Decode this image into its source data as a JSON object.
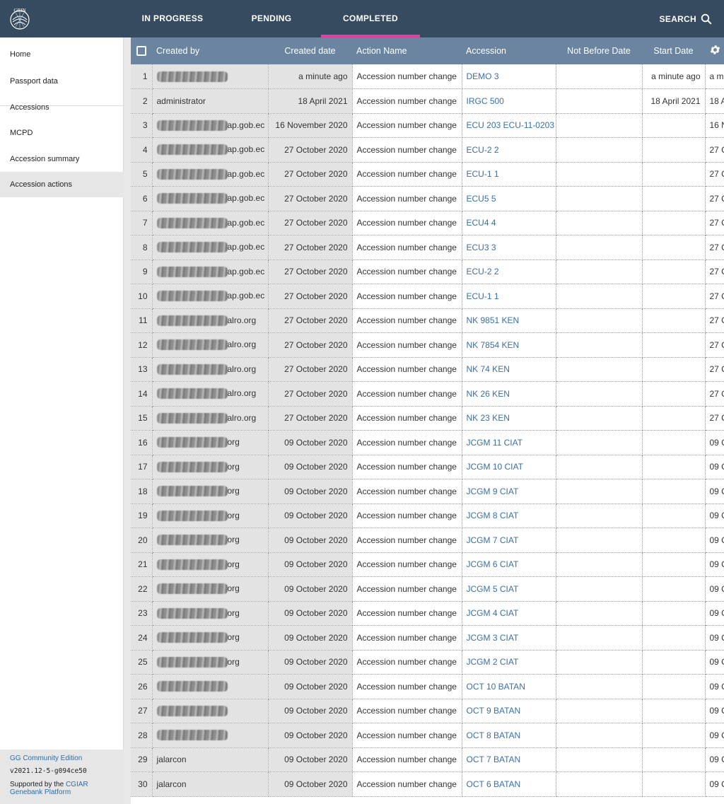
{
  "topbar": {
    "logo_text": "GRIN",
    "tabs": [
      {
        "label": "IN PROGRESS",
        "active": false
      },
      {
        "label": "PENDING",
        "active": false
      },
      {
        "label": "COMPLETED",
        "active": true
      }
    ],
    "search_label": "SEARCH",
    "search_icon": "search-icon",
    "accent_color": "#e040a0",
    "bg_color": "#364a60"
  },
  "sidebar": {
    "items": [
      {
        "label": "Home",
        "selected": false
      },
      {
        "label": "Passport data",
        "selected": false
      },
      {
        "label": "Accessions",
        "selected": false
      },
      {
        "label": "MCPD",
        "selected": false
      },
      {
        "label": "Accession summary",
        "selected": false
      },
      {
        "label": "Accession actions",
        "selected": true
      }
    ],
    "footer": {
      "edition": "GG Community Edition",
      "version": "v2021.12-5-g094ce50",
      "supported_prefix": "Supported by the",
      "supported_link": "CGIAR Genebank Platform"
    }
  },
  "table": {
    "columns": [
      "Created by",
      "Created date",
      "Action Name",
      "Accession",
      "Not Before Date",
      "Start Date"
    ],
    "settings_icon": "gear-icon",
    "rows": [
      {
        "n": "1",
        "created_by": "",
        "redacted": true,
        "created_date": "a minute ago",
        "action": "Accession number change",
        "accession": "DEMO 3",
        "not_before": "",
        "start": "a minute ago",
        "extra": "a m"
      },
      {
        "n": "2",
        "created_by": "administrator",
        "redacted": false,
        "created_date": "18 April 2021",
        "action": "Accession number change",
        "accession": "IRGC 500",
        "not_before": "",
        "start": "18 April 2021",
        "extra": "18 A"
      },
      {
        "n": "3",
        "created_by": "ap.gob.ec",
        "redacted": true,
        "created_date": "16 November 2020",
        "action": "Accession number change",
        "accession": "ECU 203 ECU-11-0203",
        "not_before": "",
        "start": "",
        "extra": "16 N"
      },
      {
        "n": "4",
        "created_by": "ap.gob.ec",
        "redacted": true,
        "created_date": "27 October 2020",
        "action": "Accession number change",
        "accession": "ECU-2 2",
        "not_before": "",
        "start": "",
        "extra": "27 C"
      },
      {
        "n": "5",
        "created_by": "ap.gob.ec",
        "redacted": true,
        "created_date": "27 October 2020",
        "action": "Accession number change",
        "accession": "ECU-1 1",
        "not_before": "",
        "start": "",
        "extra": "27 C"
      },
      {
        "n": "6",
        "created_by": "ap.gob.ec",
        "redacted": true,
        "created_date": "27 October 2020",
        "action": "Accession number change",
        "accession": "ECU5 5",
        "not_before": "",
        "start": "",
        "extra": "27 C"
      },
      {
        "n": "7",
        "created_by": "ap.gob.ec",
        "redacted": true,
        "created_date": "27 October 2020",
        "action": "Accession number change",
        "accession": "ECU4 4",
        "not_before": "",
        "start": "",
        "extra": "27 C"
      },
      {
        "n": "8",
        "created_by": "ap.gob.ec",
        "redacted": true,
        "created_date": "27 October 2020",
        "action": "Accession number change",
        "accession": "ECU3 3",
        "not_before": "",
        "start": "",
        "extra": "27 C"
      },
      {
        "n": "9",
        "created_by": "ap.gob.ec",
        "redacted": true,
        "created_date": "27 October 2020",
        "action": "Accession number change",
        "accession": "ECU-2 2",
        "not_before": "",
        "start": "",
        "extra": "27 C"
      },
      {
        "n": "10",
        "created_by": "ap.gob.ec",
        "redacted": true,
        "created_date": "27 October 2020",
        "action": "Accession number change",
        "accession": "ECU-1 1",
        "not_before": "",
        "start": "",
        "extra": "27 C"
      },
      {
        "n": "11",
        "created_by": "alro.org",
        "redacted": true,
        "created_date": "27 October 2020",
        "action": "Accession number change",
        "accession": "NK 9851 KEN",
        "not_before": "",
        "start": "",
        "extra": "27 C"
      },
      {
        "n": "12",
        "created_by": "alro.org",
        "redacted": true,
        "created_date": "27 October 2020",
        "action": "Accession number change",
        "accession": "NK 7854 KEN",
        "not_before": "",
        "start": "",
        "extra": "27 C"
      },
      {
        "n": "13",
        "created_by": "alro.org",
        "redacted": true,
        "created_date": "27 October 2020",
        "action": "Accession number change",
        "accession": "NK 74 KEN",
        "not_before": "",
        "start": "",
        "extra": "27 C"
      },
      {
        "n": "14",
        "created_by": "alro.org",
        "redacted": true,
        "created_date": "27 October 2020",
        "action": "Accession number change",
        "accession": "NK 26 KEN",
        "not_before": "",
        "start": "",
        "extra": "27 C"
      },
      {
        "n": "15",
        "created_by": "alro.org",
        "redacted": true,
        "created_date": "27 October 2020",
        "action": "Accession number change",
        "accession": "NK 23 KEN",
        "not_before": "",
        "start": "",
        "extra": "27 C"
      },
      {
        "n": "16",
        "created_by": "org",
        "redacted": true,
        "created_date": "09 October 2020",
        "action": "Accession number change",
        "accession": "JCGM 11 CIAT",
        "not_before": "",
        "start": "",
        "extra": "09 C"
      },
      {
        "n": "17",
        "created_by": "org",
        "redacted": true,
        "created_date": "09 October 2020",
        "action": "Accession number change",
        "accession": "JCGM 10 CIAT",
        "not_before": "",
        "start": "",
        "extra": "09 C"
      },
      {
        "n": "18",
        "created_by": "org",
        "redacted": true,
        "created_date": "09 October 2020",
        "action": "Accession number change",
        "accession": "JCGM 9 CIAT",
        "not_before": "",
        "start": "",
        "extra": "09 C"
      },
      {
        "n": "19",
        "created_by": "org",
        "redacted": true,
        "created_date": "09 October 2020",
        "action": "Accession number change",
        "accession": "JCGM 8 CIAT",
        "not_before": "",
        "start": "",
        "extra": "09 C"
      },
      {
        "n": "20",
        "created_by": "org",
        "redacted": true,
        "created_date": "09 October 2020",
        "action": "Accession number change",
        "accession": "JCGM 7 CIAT",
        "not_before": "",
        "start": "",
        "extra": "09 C"
      },
      {
        "n": "21",
        "created_by": "org",
        "redacted": true,
        "created_date": "09 October 2020",
        "action": "Accession number change",
        "accession": "JCGM 6 CIAT",
        "not_before": "",
        "start": "",
        "extra": "09 C"
      },
      {
        "n": "22",
        "created_by": "org",
        "redacted": true,
        "created_date": "09 October 2020",
        "action": "Accession number change",
        "accession": "JCGM 5 CIAT",
        "not_before": "",
        "start": "",
        "extra": "09 C"
      },
      {
        "n": "23",
        "created_by": "org",
        "redacted": true,
        "created_date": "09 October 2020",
        "action": "Accession number change",
        "accession": "JCGM 4 CIAT",
        "not_before": "",
        "start": "",
        "extra": "09 C"
      },
      {
        "n": "24",
        "created_by": "org",
        "redacted": true,
        "created_date": "09 October 2020",
        "action": "Accession number change",
        "accession": "JCGM 3 CIAT",
        "not_before": "",
        "start": "",
        "extra": "09 C"
      },
      {
        "n": "25",
        "created_by": "org",
        "redacted": true,
        "created_date": "09 October 2020",
        "action": "Accession number change",
        "accession": "JCGM 2 CIAT",
        "not_before": "",
        "start": "",
        "extra": "09 C"
      },
      {
        "n": "26",
        "created_by": "",
        "redacted": true,
        "created_date": "09 October 2020",
        "action": "Accession number change",
        "accession": "OCT 10 BATAN",
        "not_before": "",
        "start": "",
        "extra": "09 C"
      },
      {
        "n": "27",
        "created_by": "",
        "redacted": true,
        "created_date": "09 October 2020",
        "action": "Accession number change",
        "accession": "OCT 9 BATAN",
        "not_before": "",
        "start": "",
        "extra": "09 C"
      },
      {
        "n": "28",
        "created_by": "",
        "redacted": true,
        "created_date": "09 October 2020",
        "action": "Accession number change",
        "accession": "OCT 8 BATAN",
        "not_before": "",
        "start": "",
        "extra": "09 C"
      },
      {
        "n": "29",
        "created_by": "jalarcon",
        "redacted": false,
        "created_date": "09 October 2020",
        "action": "Accession number change",
        "accession": "OCT 7 BATAN",
        "not_before": "",
        "start": "",
        "extra": "09 C"
      },
      {
        "n": "30",
        "created_by": "jalarcon",
        "redacted": false,
        "created_date": "09 October 2020",
        "action": "Accession number change",
        "accession": "OCT 6 BATAN",
        "not_before": "",
        "start": "",
        "extra": "09 C"
      }
    ]
  }
}
